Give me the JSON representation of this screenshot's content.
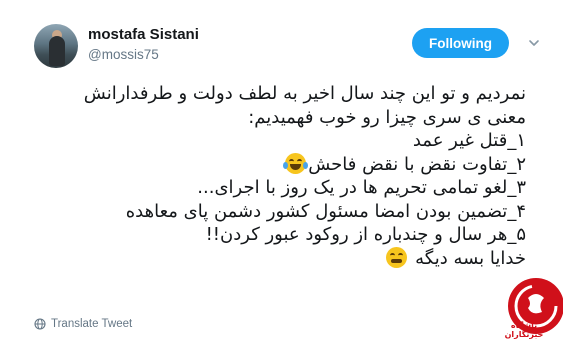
{
  "tweet": {
    "author": {
      "display_name": "mostafa Sistani",
      "handle": "@mossis75"
    },
    "follow_button_label": "Following",
    "body_lines": [
      "نمردیم و تو این چند سال اخیر به لطف  دولت و طرفدارانش",
      "معنی ی سری چیزا رو خوب فهمیدیم:",
      "۱_قتل غیر عمد",
      "۲_تفاوت نقض با نقض فاحش",
      "۳_لغو تمامی تحریم ها در یک روز با اجرای...",
      "۴_تضمین بودن امضا مسئول کشور دشمن پای معاهده",
      "۵_هر سال و  چندباره از روکود عبور کردن!!",
      "خدایا بسه دیگه"
    ],
    "emojis": [
      "face-with-tears-of-joy",
      "tired-face"
    ],
    "translate_label": "Translate Tweet"
  },
  "watermark": {
    "text": "باشگاه خبرنگاران",
    "colors": {
      "primary": "#d0101a",
      "ring": "#ffffff"
    }
  },
  "colors": {
    "accent": "#1da1f2",
    "text": "#14171a",
    "muted": "#657786"
  }
}
